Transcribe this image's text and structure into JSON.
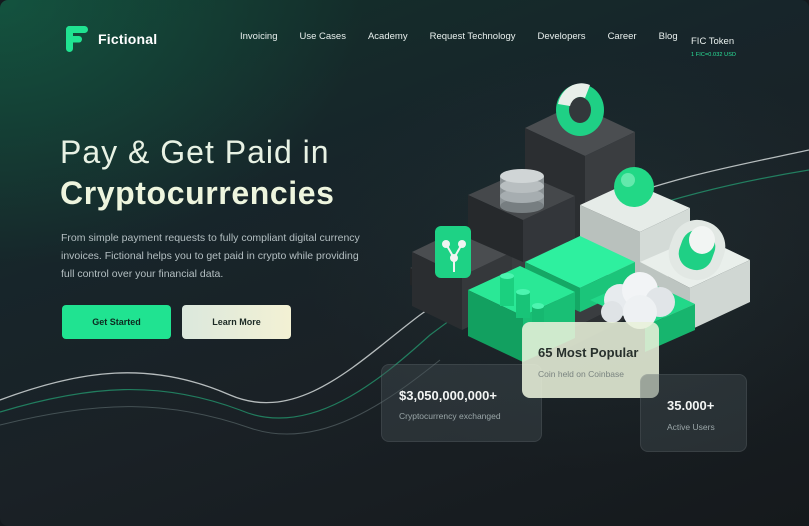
{
  "brand": {
    "name": "Fictional",
    "accent": "#20e391"
  },
  "nav": {
    "items": [
      "Invoicing",
      "Use Cases",
      "Academy",
      "Request Technology",
      "Developers",
      "Career",
      "Blog"
    ],
    "token_label": "FIC Token",
    "token_rate": "1 FIC=0.032 USD"
  },
  "hero": {
    "title_line1": "Pay & Get Paid in",
    "title_line2": "Cryptocurrencies",
    "description": "From simple payment requests to fully compliant digital currency invoices. Fictional helps you to get paid in crypto while providing full control over your financial data.",
    "primary_button": "Get Started",
    "secondary_button": "Learn More"
  },
  "stats": [
    {
      "value": "$3,050,000,000+",
      "label": "Cryptocurrency exchanged"
    },
    {
      "value": "65 Most Popular",
      "label": "Coin held on Coinbase"
    },
    {
      "value": "35.000+",
      "label": "Active Users"
    }
  ]
}
